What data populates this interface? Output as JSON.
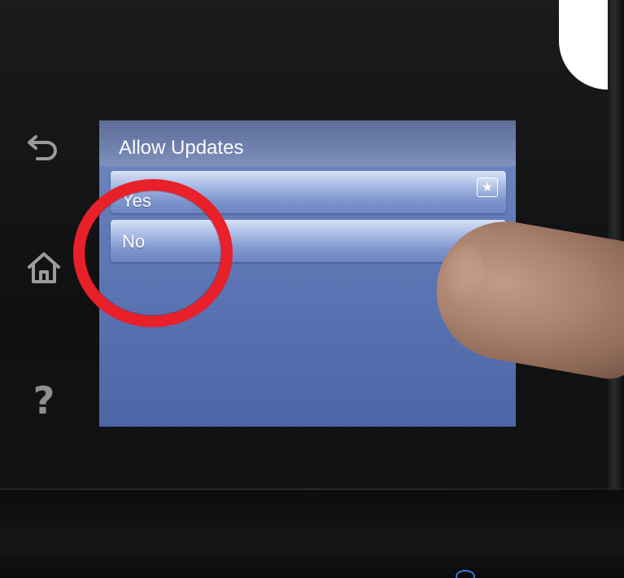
{
  "screen": {
    "title": "Allow Updates",
    "options": [
      {
        "label": "Yes",
        "selected": true,
        "badge_icon": "star-icon"
      },
      {
        "label": "No",
        "selected": false
      }
    ]
  },
  "side_buttons": [
    {
      "name": "back",
      "icon": "back-arrow-icon"
    },
    {
      "name": "home",
      "icon": "home-icon"
    },
    {
      "name": "help",
      "icon": "help-icon",
      "glyph": "?"
    }
  ],
  "annotation": {
    "shape": "circle",
    "color": "#e8202a",
    "target": "No"
  },
  "colors": {
    "screen_top": "#6f88c2",
    "screen_bottom": "#4a63a6",
    "option_highlight": "#dbe5fb",
    "bezel": "#0f1011"
  }
}
